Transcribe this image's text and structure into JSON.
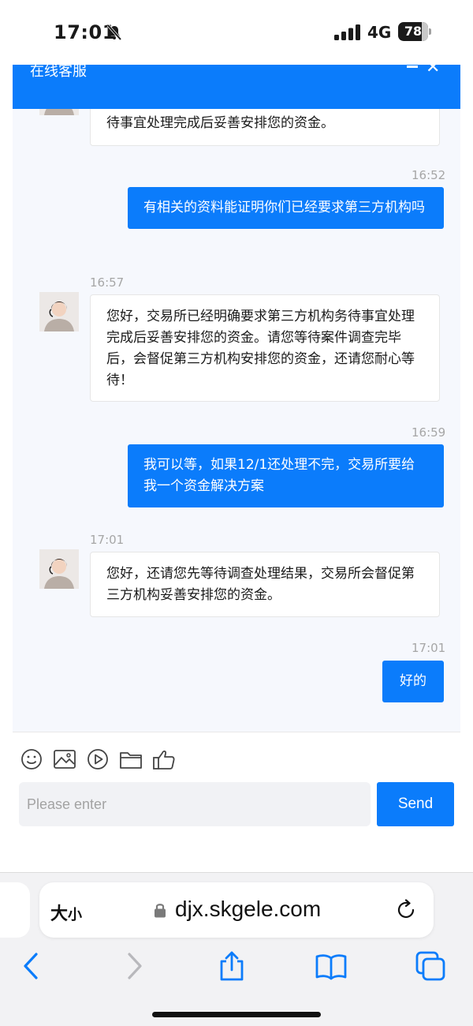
{
  "status_bar": {
    "time": "17:01",
    "network": "4G",
    "battery": "78",
    "battery_level": 0.78
  },
  "chat": {
    "title": "在线客服",
    "messages": [
      {
        "side": "in",
        "time": "",
        "text": "待事宜处理完成后妥善安排您的资金。"
      },
      {
        "side": "out",
        "time": "16:52",
        "text": "有相关的资料能证明你们已经要求第三方机构吗"
      },
      {
        "side": "in",
        "time": "16:57",
        "text": "您好，交易所已经明确要求第三方机构务待事宜处理完成后妥善安排您的资金。请您等待案件调查完毕后，会督促第三方机构安排您的资金，还请您耐心等待！"
      },
      {
        "side": "out",
        "time": "16:59",
        "text": "我可以等，如果12/1还处理不完，交易所要给我一个资金解决方案"
      },
      {
        "side": "in",
        "time": "17:01",
        "text": "您好，还请您先等待调查处理结果，交易所会督促第三方机构妥善安排您的资金。"
      },
      {
        "side": "out",
        "time": "17:01",
        "text": "好的"
      }
    ]
  },
  "composer": {
    "tools": [
      "emoji-icon",
      "image-icon",
      "video-icon",
      "folder-icon",
      "thumbs-up-icon"
    ],
    "placeholder": "Please enter",
    "send_label": "Send"
  },
  "browser": {
    "text_size_big": "大",
    "text_size_small": "小",
    "url": "djx.skgele.com",
    "accent": "#0b7cfb"
  }
}
